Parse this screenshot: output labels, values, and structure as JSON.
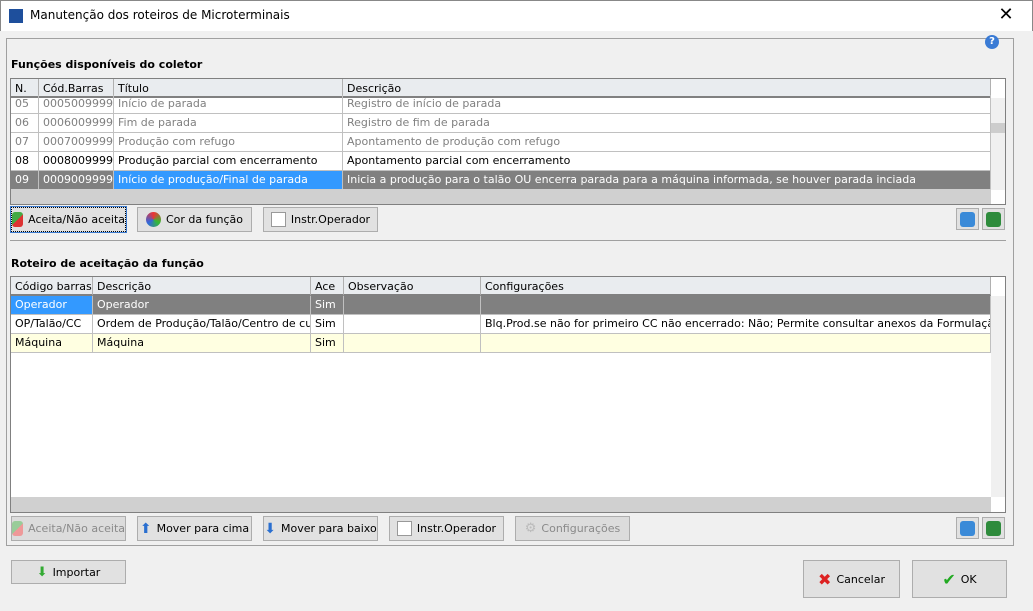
{
  "window": {
    "title": "Manutenção dos roteiros de Microterminais",
    "close": "✕"
  },
  "top": {
    "label": "Funções disponíveis do coletor",
    "columns": [
      "N.",
      "Cód.Barras",
      "Título",
      "Descrição"
    ],
    "rows": [
      [
        "05",
        "0005009999",
        "Início de parada",
        "Registro de início de parada"
      ],
      [
        "06",
        "0006009999",
        "Fim de parada",
        "Registro de fim de parada"
      ],
      [
        "07",
        "0007009999",
        "Produção com refugo",
        "Apontamento de produção com refugo"
      ],
      [
        "08",
        "0008009999",
        "Produção parcial com encerramento",
        "Apontamento parcial com encerramento"
      ],
      [
        "09",
        "0009009999",
        "Início de produção/Final de parada",
        "Inicia a produção para o talão OU encerra parada para a máquina informada, se houver parada inciada"
      ]
    ],
    "buttons": {
      "accept": "Aceita/Não aceita",
      "color": "Cor da função",
      "instr": "Instr.Operador"
    }
  },
  "bottom": {
    "label": "Roteiro de aceitação da função",
    "columns": [
      "Código barras",
      "Descrição",
      "Ace",
      "Observação",
      "Configurações"
    ],
    "rows": [
      [
        "Operador",
        "Operador",
        "Sim",
        "",
        ""
      ],
      [
        "OP/Talão/CC",
        "Ordem de Produção/Talão/Centro de custo",
        "Sim",
        "",
        "Blq.Prod.se não for primeiro CC não encerrado: Não; Permite consultar anexos da Formulação: Não; Per"
      ],
      [
        "Máquina",
        "Máquina",
        "Sim",
        "",
        ""
      ]
    ],
    "buttons": {
      "accept": "Aceita/Não aceita",
      "up": "Mover para cima",
      "down": "Mover para baixo",
      "instr": "Instr.Operador",
      "config": "Configurações"
    }
  },
  "footer": {
    "import": "Importar",
    "cancel": "Cancelar",
    "ok": "OK"
  },
  "colors": {
    "selection": "#3399ff",
    "selected_row": "#808080",
    "highlight_row": "#ffffe1"
  }
}
